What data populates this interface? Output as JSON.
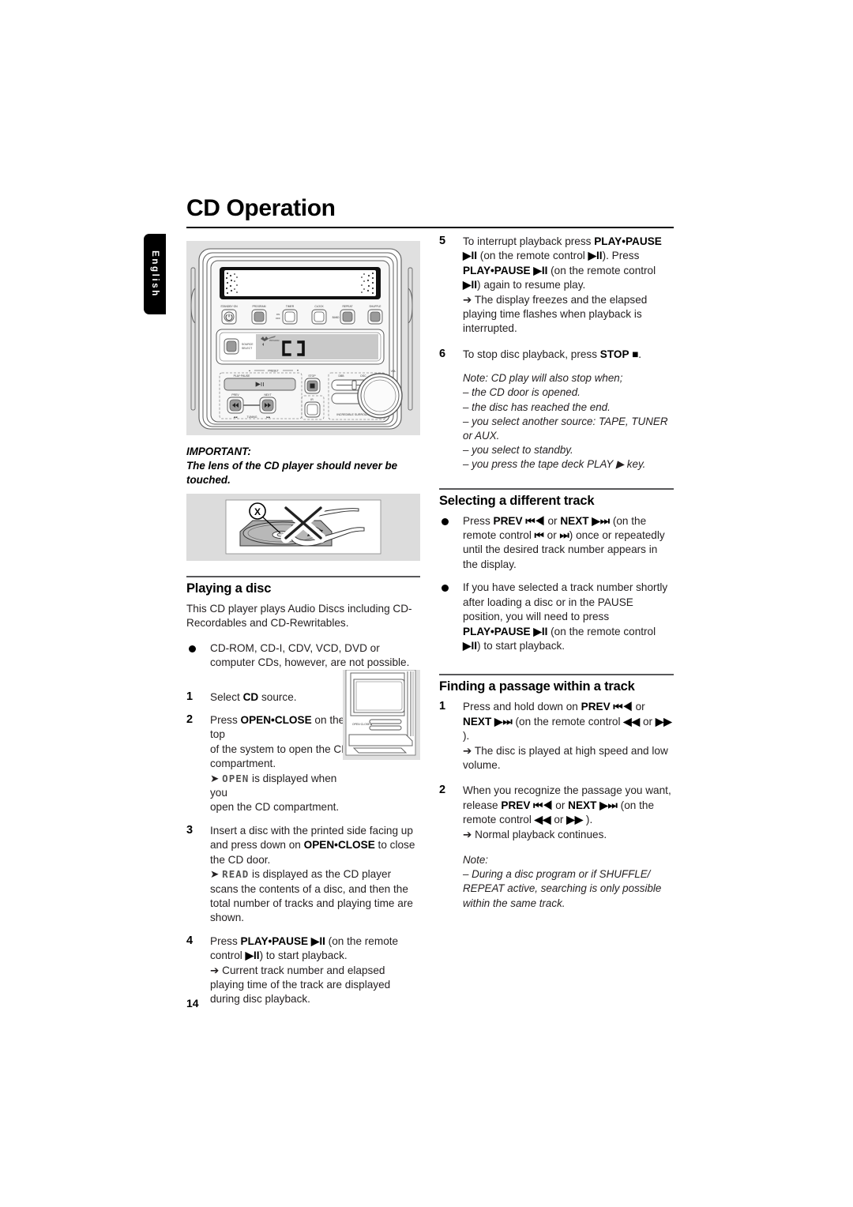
{
  "page": {
    "title": "CD Operation",
    "language_tab": "English",
    "page_number": "14"
  },
  "left_column": {
    "important": {
      "header": "IMPORTANT:",
      "body": "The lens of the CD player should never be touched."
    },
    "playing_a_disc": {
      "heading": "Playing a disc",
      "intro": "This CD player plays Audio Discs including CD-Recordables and CD-Rewritables.",
      "bullet": "CD-ROM, CD-I, CDV, VCD, DVD or computer CDs, however, are not possible.",
      "steps": [
        {
          "num": "1",
          "parts": [
            {
              "t": "Select ",
              "style": "normal"
            },
            {
              "t": "CD",
              "style": "bold"
            },
            {
              "t": " source.",
              "style": "normal"
            }
          ]
        },
        {
          "num": "2",
          "parts": [
            {
              "t": "Press ",
              "style": "normal"
            },
            {
              "t": "OPEN•CLOSE",
              "style": "bold"
            },
            {
              "t": " on the top",
              "style": "normal"
            }
          ],
          "cont": "of the system to open the CD compartment.",
          "result_prefix": "➔ ",
          "result_lcd": "OPEN",
          "result_suffix": " is displayed when you",
          "result_cont": "open the CD compartment."
        },
        {
          "num": "3",
          "parts": [
            {
              "t": "Insert a disc with the printed side facing up and press down on ",
              "style": "normal"
            },
            {
              "t": "OPEN•CLOSE",
              "style": "bold"
            },
            {
              "t": " to close the CD door.",
              "style": "normal"
            }
          ],
          "result_prefix": "➔ ",
          "result_lcd": "READ",
          "result_suffix": " is displayed as the CD player scans the contents of a disc, and then the total number of tracks and playing time are shown."
        },
        {
          "num": "4",
          "parts": [
            {
              "t": "Press ",
              "style": "normal"
            },
            {
              "t": "PLAY•PAUSE ▶II",
              "style": "bold"
            },
            {
              "t": " (on the remote control ",
              "style": "normal"
            },
            {
              "t": "▶II",
              "style": "bold"
            },
            {
              "t": ") to start playback.",
              "style": "normal"
            }
          ],
          "result": "➔ Current track number and elapsed playing time of the track are displayed during disc playback."
        }
      ]
    }
  },
  "right_column": {
    "steps": [
      {
        "num": "5",
        "parts": [
          {
            "t": "To interrupt playback press ",
            "style": "normal"
          },
          {
            "t": "PLAY•PAUSE ▶II",
            "style": "bold"
          },
          {
            "t": " (on the remote control ",
            "style": "normal"
          },
          {
            "t": "▶II",
            "style": "bold"
          },
          {
            "t": "). Press ",
            "style": "normal"
          },
          {
            "t": "PLAY•PAUSE ▶II",
            "style": "bold"
          },
          {
            "t": " (on the remote control ",
            "style": "normal"
          },
          {
            "t": "▶II",
            "style": "bold"
          },
          {
            "t": ") again to resume play.",
            "style": "normal"
          }
        ],
        "result": "➔ The display freezes and the elapsed playing time flashes when playback is interrupted."
      },
      {
        "num": "6",
        "parts": [
          {
            "t": "To stop disc playback, press ",
            "style": "normal"
          },
          {
            "t": "STOP ■",
            "style": "bold"
          },
          {
            "t": ".",
            "style": "normal"
          }
        ]
      }
    ],
    "stop_note": {
      "lead": "Note: CD play will also stop when;",
      "items": [
        "– the CD door is opened.",
        "– the disc has reached the end.",
        "– you select another source: TAPE, TUNER or AUX.",
        "– you select to standby.",
        "– you press the tape deck PLAY ▶ key."
      ]
    },
    "selecting_track": {
      "heading": "Selecting a different track",
      "bullets": [
        [
          {
            "t": "Press ",
            "style": "normal"
          },
          {
            "t": "PREV ⏮◀",
            "style": "bold"
          },
          {
            "t": " or ",
            "style": "normal"
          },
          {
            "t": "NEXT ▶⏭",
            "style": "bold"
          },
          {
            "t": " (on the remote control ",
            "style": "normal"
          },
          {
            "t": "⏮",
            "style": "bold"
          },
          {
            "t": " or ",
            "style": "normal"
          },
          {
            "t": "⏭",
            "style": "bold"
          },
          {
            "t": ") once or repeatedly until the desired track number appears in the display.",
            "style": "normal"
          }
        ],
        [
          {
            "t": "If you have selected a track number shortly after loading a disc or in the PAUSE position, you will need to press ",
            "style": "normal"
          },
          {
            "t": "PLAY•PAUSE ▶II",
            "style": "bold"
          },
          {
            "t": " (on the remote control ",
            "style": "normal"
          },
          {
            "t": "▶II",
            "style": "bold"
          },
          {
            "t": ") to start playback.",
            "style": "normal"
          }
        ]
      ]
    },
    "finding_passage": {
      "heading": "Finding a passage within a track",
      "steps": [
        {
          "num": "1",
          "parts": [
            {
              "t": "Press and hold down on ",
              "style": "normal"
            },
            {
              "t": "PREV ⏮◀",
              "style": "bold"
            },
            {
              "t": " or ",
              "style": "normal"
            },
            {
              "t": "NEXT ▶⏭",
              "style": "bold"
            },
            {
              "t": " (on the remote control ",
              "style": "normal"
            },
            {
              "t": "◀◀",
              "style": "bold"
            },
            {
              "t": " or ",
              "style": "normal"
            },
            {
              "t": "▶▶",
              "style": "bold"
            },
            {
              "t": " ).",
              "style": "normal"
            }
          ],
          "result": "➔ The disc is played at high speed and low volume."
        },
        {
          "num": "2",
          "parts": [
            {
              "t": "When you recognize the passage you want, release ",
              "style": "normal"
            },
            {
              "t": "PREV ⏮◀",
              "style": "bold"
            },
            {
              "t": " or ",
              "style": "normal"
            },
            {
              "t": "NEXT ▶⏭",
              "style": "bold"
            },
            {
              "t": " (on the remote control ",
              "style": "normal"
            },
            {
              "t": "◀◀",
              "style": "bold"
            },
            {
              "t": " or ",
              "style": "normal"
            },
            {
              "t": "▶▶",
              "style": "bold"
            },
            {
              "t": " ).",
              "style": "normal"
            }
          ],
          "result": "➔ Normal playback continues."
        }
      ],
      "note": {
        "lead": "Note:",
        "body": "–  During a disc program or if SHUFFLE/ REPEAT active, searching is only possible within the same track."
      }
    }
  },
  "device_figure": {
    "display_source": "CD",
    "top_buttons": [
      "STANDBY•ON",
      "PROGRAM",
      "TIMER",
      "CLOCK",
      "REPEAT",
      "SHUFFLE"
    ],
    "on_off_label": "ON\nOFF",
    "band_label": "BAND",
    "source_select_label": "SOURCE\nSELECT",
    "preset_label": "PRESET",
    "play_pause_label": "PLAY•PAUSE",
    "prev_label": "PREV",
    "next_label": "NEXT",
    "tuning_label": "TUNING",
    "stop_label": "STOP",
    "ir_label": "IR",
    "dbb_label": "DBB",
    "dsc_label": "DSC",
    "incredible_surround_label": "INCREDIBLE SURROUND",
    "vol_label": "VOL"
  },
  "tray_figure": {
    "open_close_label": "OPEN•CLOSE"
  },
  "lens_figure": {
    "marker": "X"
  },
  "colors": {
    "rule": "#58585a",
    "figure_bg": "#e0e0e0",
    "text": "#231f20",
    "tab_bg": "#000000"
  }
}
